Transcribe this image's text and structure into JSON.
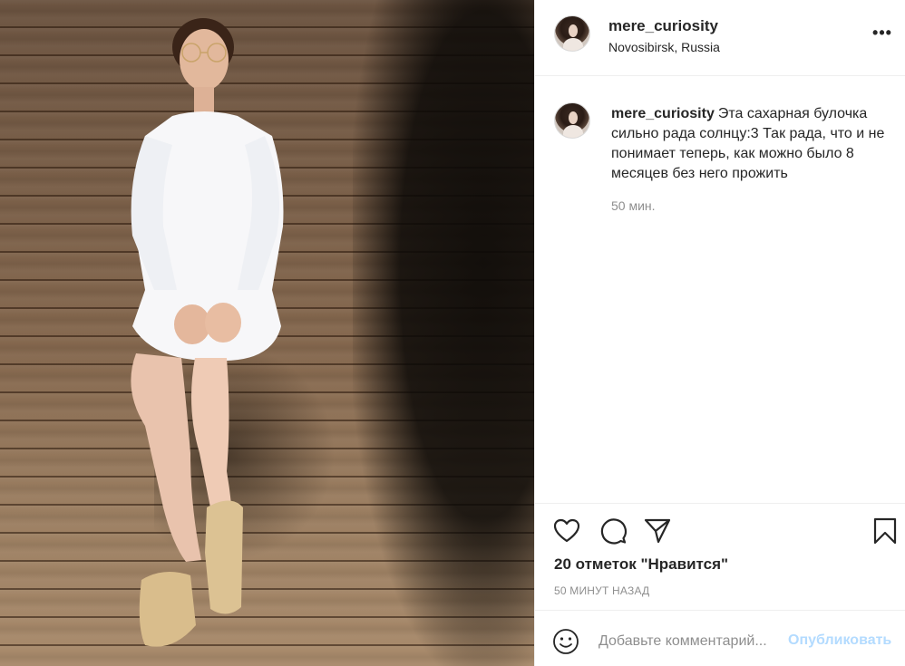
{
  "post": {
    "image_alt": "Photo of a woman in a white sweatshirt dress sitting against a wooden wall",
    "author": {
      "username": "mere_curiosity",
      "location": "Novosibirsk, Russia"
    },
    "more_icon": "more-horizontal-icon",
    "more_label": "•••",
    "caption": {
      "username": "mere_curiosity",
      "text": "Эта сахарная булочка сильно рада солнцу:3 Так рада, что и не понимает теперь, как можно было 8 месяцев без него прожить",
      "time": "50 мин."
    },
    "actions": {
      "like_icon": "heart-icon",
      "comment_icon": "comment-icon",
      "share_icon": "paper-plane-icon",
      "save_icon": "bookmark-icon"
    },
    "likes_text": "20 отметок \"Нравится\"",
    "timestamp": "50 МИНУТ НАЗАД",
    "comment_form": {
      "emoji_icon": "smiley-icon",
      "placeholder": "Добавьте комментарий...",
      "publish_label": "Опубликовать"
    }
  }
}
